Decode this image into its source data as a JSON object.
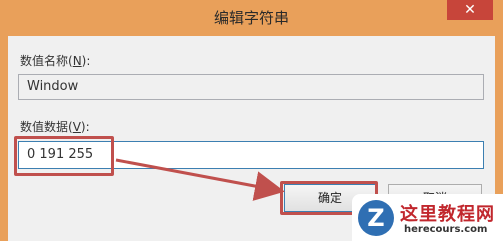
{
  "window": {
    "title": "编辑字符串",
    "close_glyph": "✕"
  },
  "value_name": {
    "label_prefix": "数值名称(",
    "label_key": "N",
    "label_suffix": "):",
    "value": "Window"
  },
  "value_data": {
    "label_prefix": "数值数据(",
    "label_key": "V",
    "label_suffix": "):",
    "value": "0 191 255"
  },
  "buttons": {
    "ok": "确定",
    "cancel": "取消"
  },
  "annotation": {
    "color": "#c0504d"
  },
  "watermark": {
    "logo_letter": "Z",
    "cn_text": "这里教程网",
    "en_text": "herecours.com"
  }
}
